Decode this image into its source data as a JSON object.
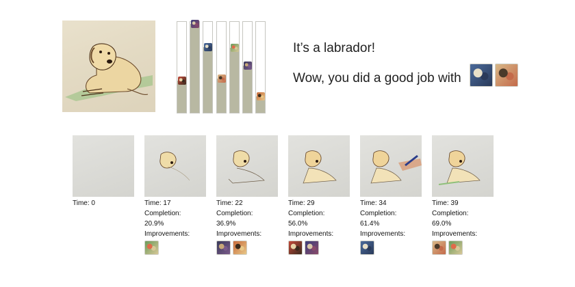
{
  "headline": "It’s a labrador!",
  "good_job_text": "Wow, you did a good job with",
  "good_job_icons": [
    "dog-thumbnail-icon",
    "dog-thumbnail-icon"
  ],
  "colors": {
    "paper": "#e6dec8",
    "bar_fill": "#b8b8a2",
    "grass": "#8fc07a",
    "dog_body": "#e8cf94",
    "ink": "#3a2a1a"
  },
  "bars": [
    {
      "level": 0.35,
      "icon": "dog-thumbnail-icon"
    },
    {
      "level": 0.96,
      "icon": "dog-thumbnail-icon"
    },
    {
      "level": 0.71,
      "icon": "dog-thumbnail-icon"
    },
    {
      "level": 0.37,
      "icon": "dog-thumbnail-icon"
    },
    {
      "level": 0.7,
      "icon": "dog-thumbnail-icon"
    },
    {
      "level": 0.51,
      "icon": "dog-thumbnail-icon"
    },
    {
      "level": 0.18,
      "icon": "dog-thumbnail-icon"
    }
  ],
  "timeline": [
    {
      "time": "Time: 0",
      "completion_label": "",
      "completion": "",
      "improvements_label": "",
      "improvements": 0
    },
    {
      "time": "Time: 17",
      "completion_label": "Completion:",
      "completion": "20.9%",
      "improvements_label": "Improvements:",
      "improvements": 1
    },
    {
      "time": "Time: 22",
      "completion_label": "Completion:",
      "completion": "36.9%",
      "improvements_label": "Improvements:",
      "improvements": 2
    },
    {
      "time": "Time: 29",
      "completion_label": "Completion:",
      "completion": "56.0%",
      "improvements_label": "Improvements:",
      "improvements": 2
    },
    {
      "time": "Time: 34",
      "completion_label": "Completion:",
      "completion": "61.4%",
      "improvements_label": "Improvements:",
      "improvements": 1
    },
    {
      "time": "Time: 39",
      "completion_label": "Completion:",
      "completion": "69.0%",
      "improvements_label": "Improvements:",
      "improvements": 2
    }
  ]
}
